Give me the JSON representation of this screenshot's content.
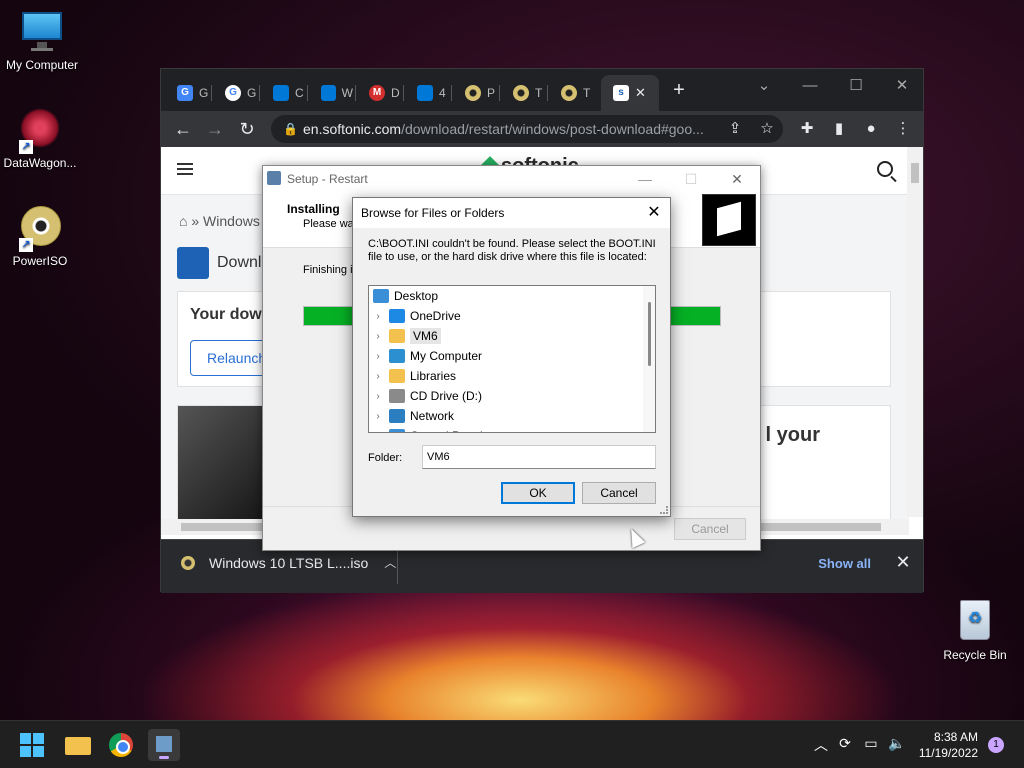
{
  "desktop": {
    "icons": [
      {
        "label": "My Computer",
        "icon": "monitor-icon"
      },
      {
        "label": "DataWagon...",
        "icon": "datawagon-icon"
      },
      {
        "label": "PowerISO",
        "icon": "disc-icon"
      },
      {
        "label": "Recycle Bin",
        "icon": "recycle-bin-icon"
      }
    ]
  },
  "browser": {
    "tabs": [
      {
        "letter": "G",
        "favicon": "google-translate-icon",
        "color": "#4285f4"
      },
      {
        "letter": "G",
        "favicon": "google-icon",
        "color": "#ffffff"
      },
      {
        "letter": "C",
        "favicon": "windows-icon",
        "color": "#0078d7"
      },
      {
        "letter": "W",
        "favicon": "windows-icon",
        "color": "#0078d7"
      },
      {
        "letter": "D",
        "favicon": "m-icon",
        "color": "#d32f2f"
      },
      {
        "letter": "4",
        "favicon": "windows-icon",
        "color": "#0078d7"
      },
      {
        "letter": "P",
        "favicon": "disc-icon",
        "color": "#d4c070"
      },
      {
        "letter": "T",
        "favicon": "disc-icon",
        "color": "#d4c070"
      },
      {
        "letter": "T",
        "favicon": "disc-icon",
        "color": "#d4c070"
      }
    ],
    "active_tab_close": "✕",
    "new_tab": "+",
    "address": {
      "domain": "en.softonic.com",
      "path": "/download/restart/windows/post-download#goo..."
    },
    "page": {
      "logo": "softonic",
      "breadcrumb": "Windows",
      "download_title": "Downlo",
      "your_download": "Your dow",
      "relaunch": "Relaunch",
      "promo": "l your"
    },
    "shelf": {
      "file": "Windows 10 LTSB L....iso",
      "show_all": "Show all"
    }
  },
  "setup": {
    "title": "Setup - Restart",
    "heading": "Installing",
    "subheading": "Please wai",
    "status": "Finishing in",
    "progress": 1.0,
    "cancel": "Cancel"
  },
  "browse": {
    "title": "Browse for Files or Folders",
    "message": "C:\\BOOT.INI couldn't be found. Please select the BOOT.INI file to use, or the hard disk drive where this file is located:",
    "tree": [
      {
        "label": "Desktop",
        "icon": "desktop-folder-icon",
        "color": "#3a8fd6",
        "level": 0,
        "expandable": false
      },
      {
        "label": "OneDrive",
        "icon": "cloud-icon",
        "color": "#1e88e5",
        "level": 1,
        "expandable": true
      },
      {
        "label": "VM6",
        "icon": "folder-icon",
        "color": "#f2c14e",
        "level": 1,
        "expandable": true,
        "selected": true
      },
      {
        "label": "My Computer",
        "icon": "computer-icon",
        "color": "#2b8fd0",
        "level": 1,
        "expandable": true
      },
      {
        "label": "Libraries",
        "icon": "libraries-icon",
        "color": "#f2c14e",
        "level": 1,
        "expandable": true
      },
      {
        "label": "CD Drive (D:)",
        "icon": "cd-drive-icon",
        "color": "#8a8a8a",
        "level": 1,
        "expandable": true
      },
      {
        "label": "Network",
        "icon": "network-icon",
        "color": "#2b7fc0",
        "level": 1,
        "expandable": true
      },
      {
        "label": "Control Panel",
        "icon": "control-panel-icon",
        "color": "#3a8fd6",
        "level": 1,
        "expandable": true
      }
    ],
    "folder_label": "Folder:",
    "folder_value": "VM6",
    "ok": "OK",
    "cancel": "Cancel"
  },
  "taskbar": {
    "time": "8:38 AM",
    "date": "11/19/2022",
    "notifications": "1"
  }
}
